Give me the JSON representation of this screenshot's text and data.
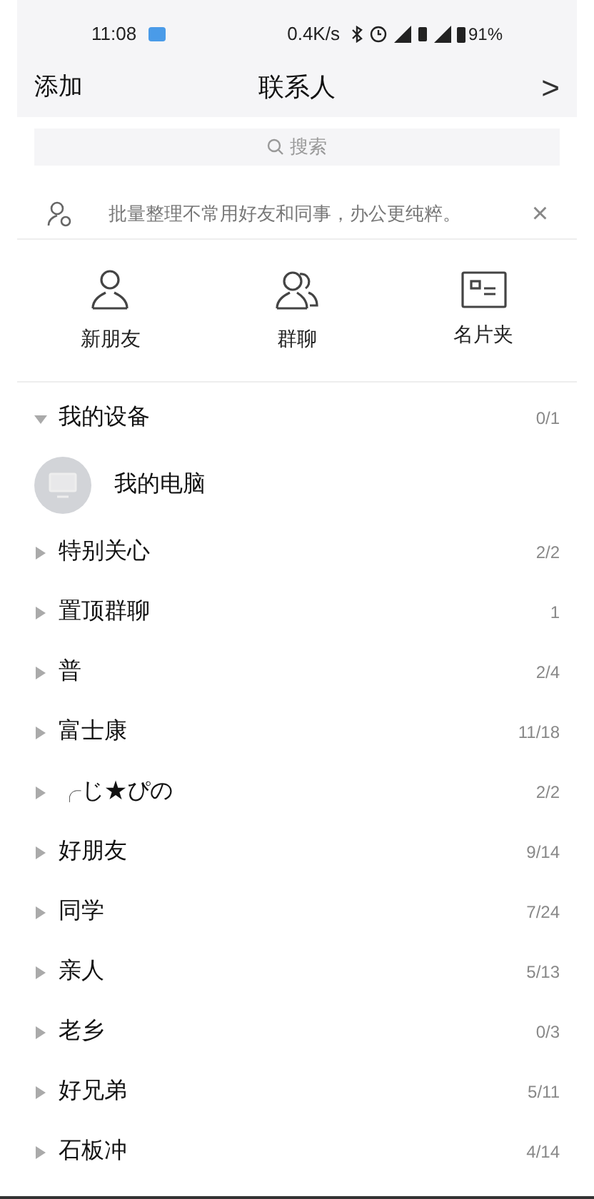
{
  "status_bar": {
    "time": "11:08",
    "speed": "0.4K/s",
    "battery": "91%"
  },
  "header": {
    "left": "添加",
    "title": "联系人",
    "right": ">"
  },
  "search": {
    "placeholder": "搜索"
  },
  "banner": {
    "text": "批量整理不常用好友和同事，办公更纯粹。",
    "close": "×"
  },
  "shortcuts": [
    {
      "kind": "person",
      "label": "新朋友"
    },
    {
      "kind": "group",
      "label": "群聊"
    },
    {
      "kind": "card",
      "label": "名片夹"
    }
  ],
  "groups": [
    {
      "name": "我的设备",
      "count": "0/1",
      "expanded": true,
      "children": [
        {
          "name": "我的电脑"
        }
      ]
    },
    {
      "name": "特别关心",
      "count": "2/2",
      "expanded": false
    },
    {
      "name": "置顶群聊",
      "count": "1",
      "expanded": false
    },
    {
      "name": "普",
      "count": "2/4",
      "expanded": false
    },
    {
      "name": "富士康",
      "count": "11/18",
      "expanded": false
    },
    {
      "name": "╭じ★ぴの",
      "count": "2/2",
      "expanded": false
    },
    {
      "name": "好朋友",
      "count": "9/14",
      "expanded": false
    },
    {
      "name": "同学",
      "count": "7/24",
      "expanded": false
    },
    {
      "name": "亲人",
      "count": "5/13",
      "expanded": false
    },
    {
      "name": "老乡",
      "count": "0/3",
      "expanded": false
    },
    {
      "name": "好兄弟",
      "count": "5/11",
      "expanded": false
    },
    {
      "name": "石板冲",
      "count": "4/14",
      "expanded": false
    }
  ]
}
